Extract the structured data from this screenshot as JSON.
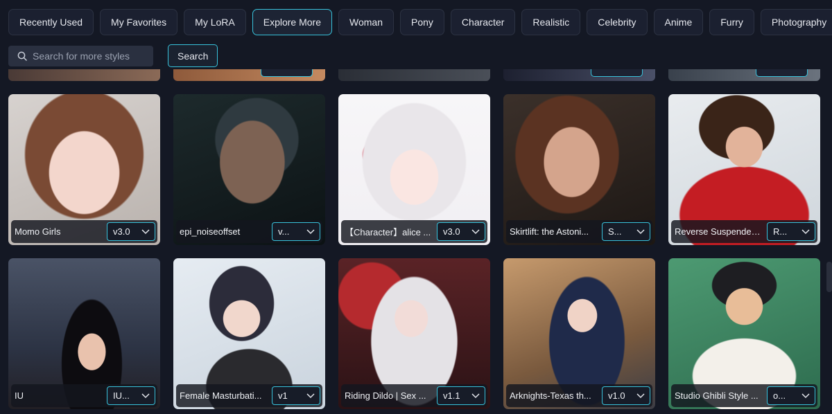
{
  "tabs": [
    {
      "label": "Recently Used",
      "active": false
    },
    {
      "label": "My Favorites",
      "active": false
    },
    {
      "label": "My LoRA",
      "active": false
    },
    {
      "label": "Explore More",
      "active": true
    },
    {
      "label": "Woman",
      "active": false
    },
    {
      "label": "Pony",
      "active": false
    },
    {
      "label": "Character",
      "active": false
    },
    {
      "label": "Realistic",
      "active": false
    },
    {
      "label": "Celebrity",
      "active": false
    },
    {
      "label": "Anime",
      "active": false
    },
    {
      "label": "Furry",
      "active": false
    },
    {
      "label": "Photography",
      "active": false
    }
  ],
  "search": {
    "placeholder": "Search for more styles",
    "value": "",
    "button_label": "Search"
  },
  "cards": [
    {
      "name": "Momo Girls",
      "version": "v3.0"
    },
    {
      "name": "epi_noiseoffset",
      "version": "v..."
    },
    {
      "name": "【Character】alice ...",
      "version": "v3.0"
    },
    {
      "name": "Skirtlift: the Astoni...",
      "version": "S..."
    },
    {
      "name": "Reverse Suspended...",
      "version": "R..."
    },
    {
      "name": "IU",
      "version": "IU..."
    },
    {
      "name": "Female Masturbati...",
      "version": "v1"
    },
    {
      "name": "Riding Dildo | Sex ...",
      "version": "v1.1"
    },
    {
      "name": "Arknights-Texas th...",
      "version": "v1.0"
    },
    {
      "name": "Studio Ghibli Style ...",
      "version": "o..."
    }
  ],
  "colors": {
    "accent": "#38c3dc",
    "background": "#141824"
  }
}
